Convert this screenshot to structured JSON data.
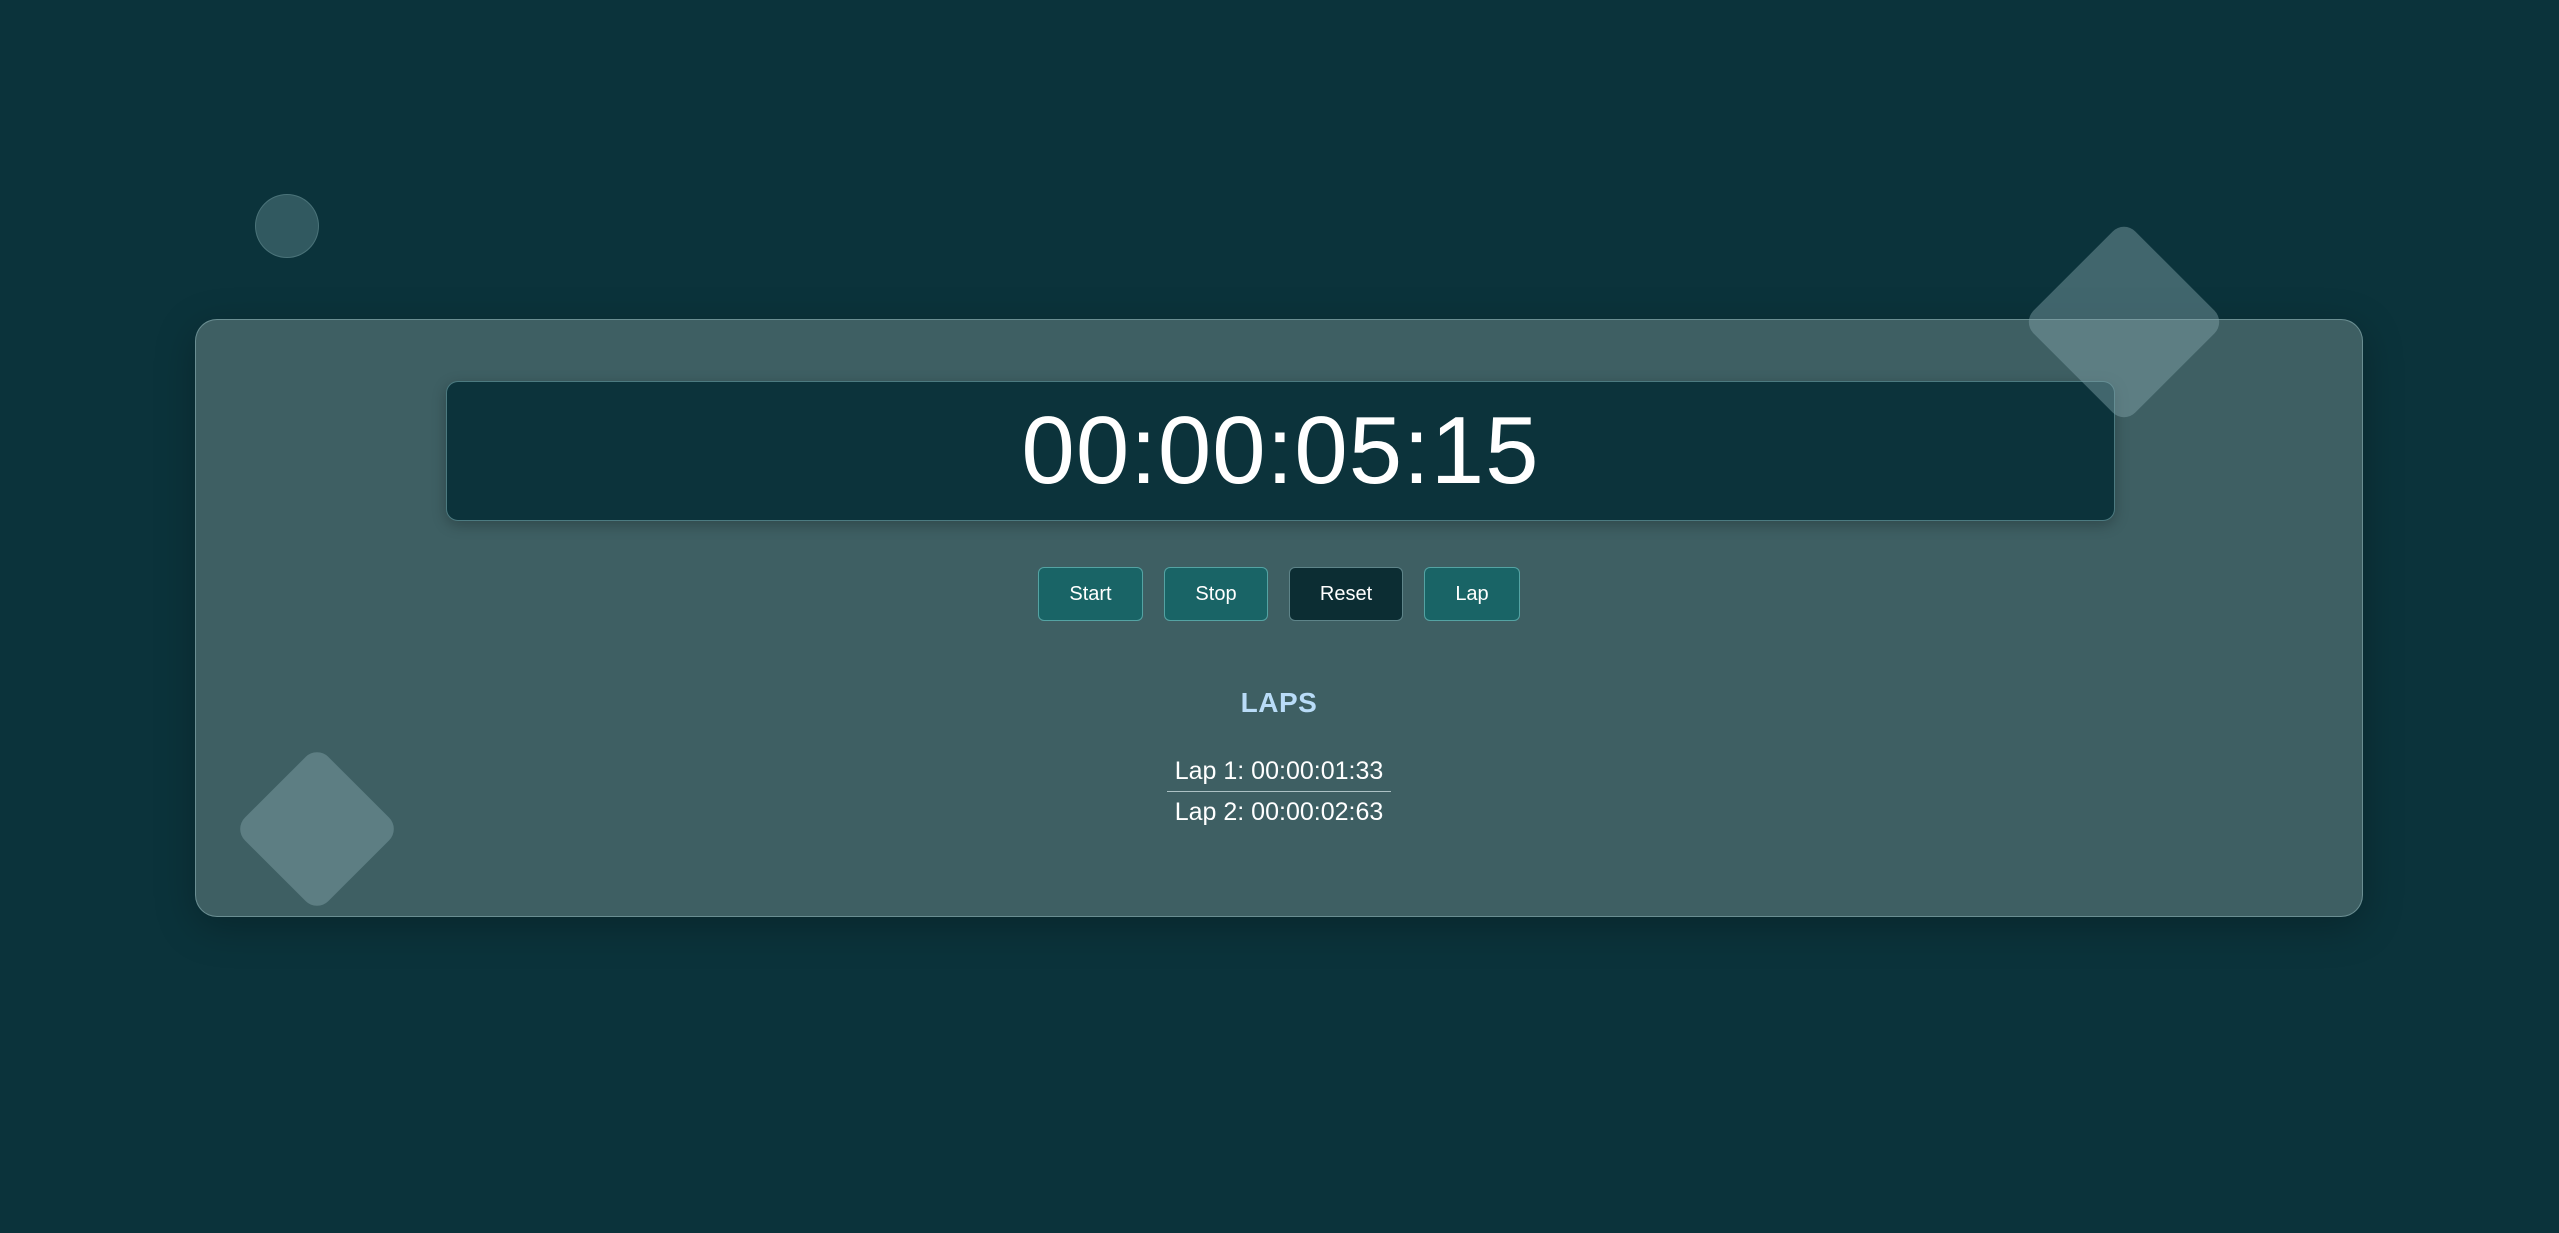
{
  "stopwatch": {
    "display": "00:00:05:15"
  },
  "controls": {
    "start_label": "Start",
    "stop_label": "Stop",
    "reset_label": "Reset",
    "lap_label": "Lap"
  },
  "laps": {
    "title": "LAPS",
    "items": [
      {
        "label": "Lap 1: 00:00:01:33"
      },
      {
        "label": "Lap 2: 00:00:02:63"
      }
    ]
  },
  "colors": {
    "background": "#0b333b",
    "card": "#3e5f63",
    "timer_box": "#0c333b",
    "button_teal": "#196466",
    "button_dark": "#0c2d33",
    "laps_title": "#b9dcf8"
  }
}
